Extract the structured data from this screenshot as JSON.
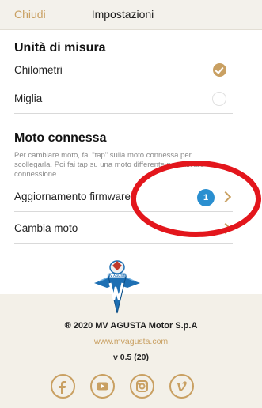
{
  "header": {
    "close_label": "Chiudi",
    "title": "Impostazioni"
  },
  "units": {
    "title": "Unità di misura",
    "options": [
      {
        "label": "Chilometri",
        "selected": true
      },
      {
        "label": "Miglia",
        "selected": false
      }
    ]
  },
  "connected": {
    "title": "Moto connessa",
    "description": "Per cambiare moto, fai \"tap\" sulla moto connessa per scollegarla. Poi fai tap su una moto differente per attivare la connessione.",
    "items": [
      {
        "label": "Aggiornamento firmware",
        "badge": "1"
      },
      {
        "label": "Cambia moto"
      }
    ]
  },
  "footer": {
    "copyright": "® 2020 MV AGUSTA Motor S.p.A",
    "website": "www.mvagusta.com",
    "version": "v 0.5 (20)",
    "logo_text": "MV AGUSTA",
    "social": [
      "facebook-icon",
      "youtube-icon",
      "instagram-icon",
      "vimeo-icon"
    ]
  },
  "colors": {
    "accent": "#c9a062",
    "badge": "#2a8fd0",
    "highlight": "#e3161c",
    "footer_bg": "#f3f0e8",
    "nav_bg": "#f3f1eb"
  }
}
